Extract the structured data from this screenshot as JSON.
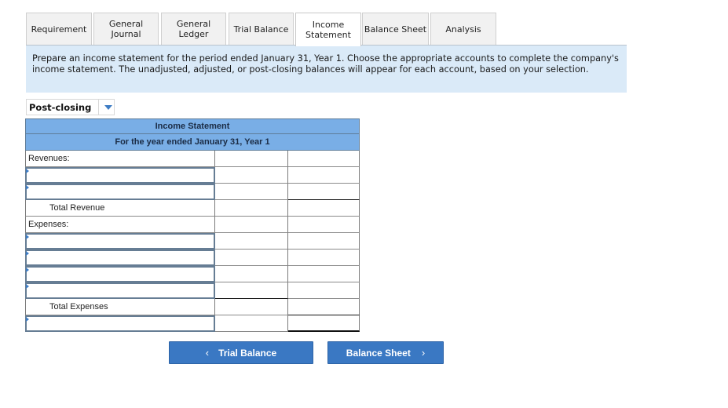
{
  "tabs": [
    {
      "label": "Requirement",
      "active": false
    },
    {
      "label": "General\nJournal",
      "active": false
    },
    {
      "label": "General\nLedger",
      "active": false
    },
    {
      "label": "Trial Balance",
      "active": false
    },
    {
      "label": "Income\nStatement",
      "active": true
    },
    {
      "label": "Balance Sheet",
      "active": false
    },
    {
      "label": "Analysis",
      "active": false
    }
  ],
  "instructions": "Prepare an income statement for the period ended January 31, Year 1. Choose the appropriate accounts to complete the company's income statement. The unadjusted, adjusted, or post-closing balances will appear for each account, based on your selection.",
  "balance_select": {
    "value": "Post-closing",
    "icon": "chevron-down-icon"
  },
  "statement": {
    "title": "Income Statement",
    "period": "For the year ended January 31, Year 1",
    "revenues_label": "Revenues:",
    "total_revenue_label": "Total Revenue",
    "expenses_label": "Expenses:",
    "total_expenses_label": "Total Expenses"
  },
  "nav": {
    "prev_label": "Trial Balance",
    "prev_icon": "‹",
    "next_label": "Balance Sheet",
    "next_icon": "›"
  }
}
